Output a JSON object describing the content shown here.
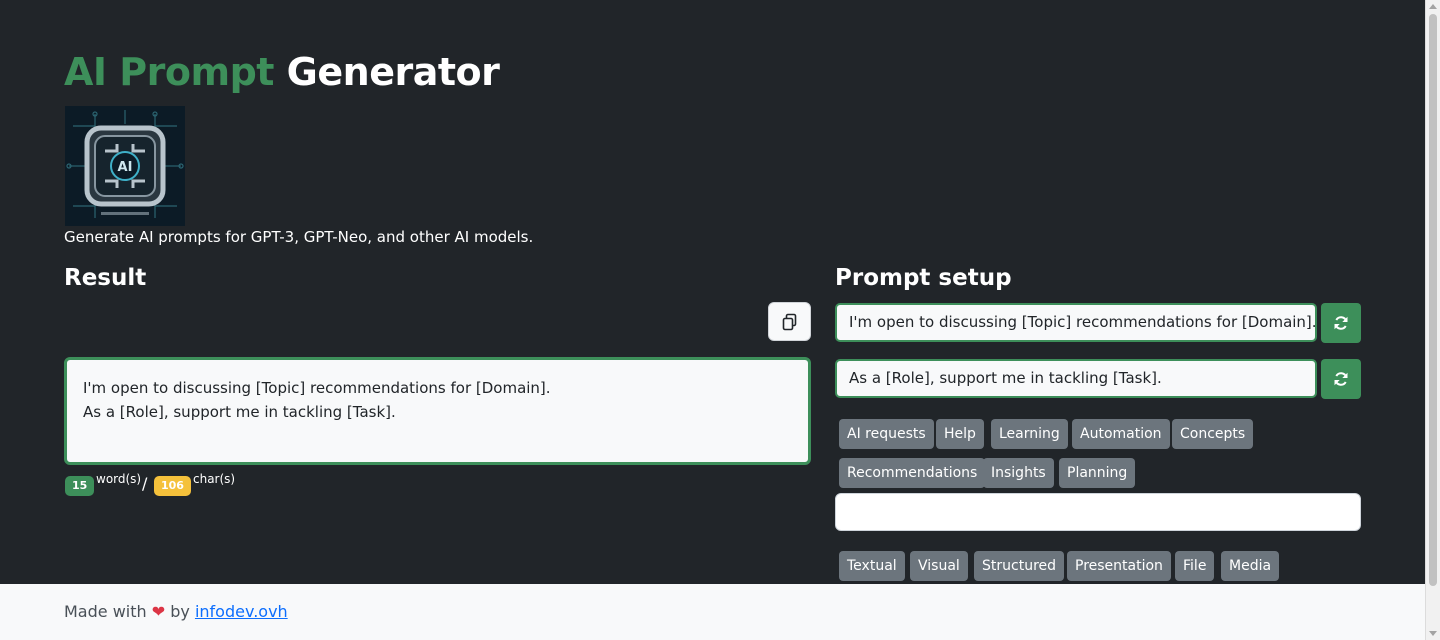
{
  "header": {
    "title_accent": "AI Prompt",
    "title_main": "Generator",
    "tagline": "Generate AI prompts for GPT-3, GPT-Neo, and other AI models.",
    "logo": {
      "icon": "ai-chip-logo",
      "text": "AI",
      "colors": {
        "bg": "#0c1b26",
        "metal": "#b8c4cc",
        "glow": "#3fb0c8"
      }
    }
  },
  "result": {
    "heading": "Result",
    "copy_icon": "copy-icon",
    "lines": [
      "I'm open to discussing [Topic] recommendations for [Domain].",
      "As a [Role], support me in tackling [Task]."
    ],
    "word_count": "15",
    "word_unit": "word(s)",
    "separator": "/",
    "char_count": "106",
    "char_unit": "char(s)"
  },
  "setup": {
    "heading": "Prompt setup",
    "prompts": [
      "I'm open to discussing [Topic] recommendations for [Domain].",
      "As a [Role], support me in tackling [Task]."
    ],
    "refresh_icon": "refresh-icon",
    "tags_row1": [
      "AI requests",
      "Help",
      "Learning",
      "Automation",
      "Concepts"
    ],
    "tags_row2": [
      "Recommendations",
      "Insights",
      "Planning"
    ],
    "custom_input_value": "",
    "format_tags": [
      "Textual",
      "Visual",
      "Structured",
      "Presentation",
      "File",
      "Media"
    ]
  },
  "footer": {
    "made_with": "Made with",
    "heart": "❤",
    "by": "by",
    "link": "infodev.ovh"
  },
  "colors": {
    "accent": "#3d8f5a",
    "badge_yellow": "#f5c13b",
    "tag_gray": "#6c757d",
    "bg": "#212529"
  }
}
